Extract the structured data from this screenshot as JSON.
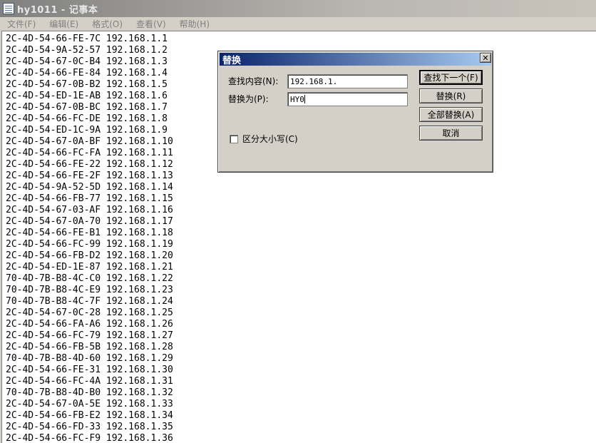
{
  "window": {
    "title": "hy1011 - 记事本",
    "icon": "notepad-icon"
  },
  "menu": [
    {
      "label": "文件(F)"
    },
    {
      "label": "编辑(E)"
    },
    {
      "label": "格式(O)"
    },
    {
      "label": "查看(V)"
    },
    {
      "label": "帮助(H)"
    }
  ],
  "editor": {
    "lines": [
      "2C-4D-54-66-FE-7C 192.168.1.1",
      "2C-4D-54-9A-52-57 192.168.1.2",
      "2C-4D-54-67-0C-B4 192.168.1.3",
      "2C-4D-54-66-FE-84 192.168.1.4",
      "2C-4D-54-67-0B-B2 192.168.1.5",
      "2C-4D-54-ED-1E-AB 192.168.1.6",
      "2C-4D-54-67-0B-BC 192.168.1.7",
      "2C-4D-54-66-FC-DE 192.168.1.8",
      "2C-4D-54-ED-1C-9A 192.168.1.9",
      "2C-4D-54-67-0A-BF 192.168.1.10",
      "2C-4D-54-66-FC-FA 192.168.1.11",
      "2C-4D-54-66-FE-22 192.168.1.12",
      "2C-4D-54-66-FE-2F 192.168.1.13",
      "2C-4D-54-9A-52-5D 192.168.1.14",
      "2C-4D-54-66-FB-77 192.168.1.15",
      "2C-4D-54-67-03-AF 192.168.1.16",
      "2C-4D-54-67-0A-70 192.168.1.17",
      "2C-4D-54-66-FE-B1 192.168.1.18",
      "2C-4D-54-66-FC-99 192.168.1.19",
      "2C-4D-54-66-FB-D2 192.168.1.20",
      "2C-4D-54-ED-1E-87 192.168.1.21",
      "70-4D-7B-B8-4C-C0 192.168.1.22",
      "70-4D-7B-B8-4C-E9 192.168.1.23",
      "70-4D-7B-B8-4C-7F 192.168.1.24",
      "2C-4D-54-67-0C-28 192.168.1.25",
      "2C-4D-54-66-FA-A6 192.168.1.26",
      "2C-4D-54-66-FC-79 192.168.1.27",
      "2C-4D-54-66-FB-5B 192.168.1.28",
      "70-4D-7B-B8-4D-60 192.168.1.29",
      "2C-4D-54-66-FE-31 192.168.1.30",
      "2C-4D-54-66-FC-4A 192.168.1.31",
      "70-4D-7B-B8-4D-B0 192.168.1.32",
      "2C-4D-54-67-0A-5E 192.168.1.33",
      "2C-4D-54-66-FB-E2 192.168.1.34",
      "2C-4D-54-66-FD-33 192.168.1.35",
      "2C-4D-54-66-FC-F9 192.168.1.36"
    ]
  },
  "replace_dialog": {
    "title": "替换",
    "close_icon": "close-icon",
    "find_label": "查找内容(N):",
    "find_value": "192.168.1.",
    "replace_label": "替换为(P):",
    "replace_value": "HY0",
    "match_case_label": "区分大小写(C)",
    "match_case_checked": false,
    "buttons": {
      "find_next": "查找下一个(F)",
      "replace": "替换(R)",
      "replace_all": "全部替换(A)",
      "cancel": "取消"
    }
  }
}
